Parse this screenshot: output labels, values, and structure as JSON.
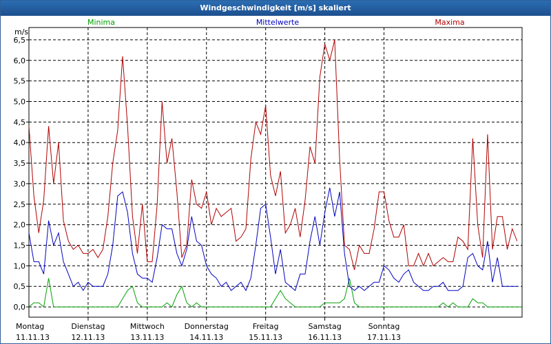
{
  "window": {
    "title": "Windgeschwindigkeit [m/s] skaliert"
  },
  "chart_data": {
    "type": "line",
    "title": "Windgeschwindigkeit [m/s] skaliert",
    "ylabel": "m/s",
    "ylim": [
      -0.25,
      6.8
    ],
    "yticks": [
      "0,0",
      "0,5",
      "1,0",
      "1,5",
      "2,0",
      "2,5",
      "3,0",
      "3,5",
      "4,0",
      "4,5",
      "5,0",
      "5,5",
      "6,0",
      "6,5"
    ],
    "grid": true,
    "x_start": "11.11.13 00:00",
    "x_step_hours": 2,
    "xtick_labels": [
      {
        "day": "Montag",
        "date": "11.11.13"
      },
      {
        "day": "Dienstag",
        "date": "12.11.13"
      },
      {
        "day": "Mittwoch",
        "date": "13.11.13"
      },
      {
        "day": "Donnerstag",
        "date": "14.11.13"
      },
      {
        "day": "Freitag",
        "date": "15.11.13"
      },
      {
        "day": "Samstag",
        "date": "16.11.13"
      },
      {
        "day": "Sonntag",
        "date": "17.11.13"
      }
    ],
    "colors": {
      "min": "#00a000",
      "mean": "#0000c0",
      "max": "#b00000",
      "grid": "#000000"
    },
    "series": [
      {
        "name": "Minima",
        "color": "#00a000",
        "values": [
          0,
          0.1,
          0.1,
          0,
          0.7,
          0,
          0,
          0,
          0,
          0,
          0,
          0,
          0,
          0,
          0,
          0,
          0,
          0,
          0,
          0.2,
          0.4,
          0.5,
          0.1,
          0,
          0,
          0,
          0,
          0,
          0.1,
          0,
          0.3,
          0.5,
          0.1,
          0,
          0.1,
          0,
          0,
          0,
          0,
          0,
          0,
          0,
          0,
          0,
          0,
          0,
          0,
          0,
          0,
          0,
          0.2,
          0.4,
          0.2,
          0.1,
          0,
          0,
          0,
          0,
          0,
          0,
          0.1,
          0.1,
          0.1,
          0.1,
          0.2,
          0.7,
          0.1,
          0,
          0,
          0,
          0,
          0,
          0,
          0,
          0,
          0,
          0,
          0,
          0,
          0,
          0,
          0,
          0,
          0,
          0.1,
          0,
          0.1,
          0,
          0,
          0,
          0.2,
          0.1,
          0.1,
          0,
          0,
          0,
          0,
          0,
          0,
          0,
          0
        ]
      },
      {
        "name": "Mittelwerte",
        "color": "#0000c0",
        "values": [
          1.8,
          1.1,
          1.1,
          0.8,
          2.1,
          1.5,
          1.8,
          1.1,
          0.8,
          0.5,
          0.6,
          0.4,
          0.6,
          0.5,
          0.5,
          0.5,
          0.8,
          1.5,
          2.7,
          2.8,
          2.3,
          1.3,
          0.8,
          0.7,
          0.7,
          0.6,
          1.2,
          2.0,
          1.9,
          1.9,
          1.3,
          1.0,
          1.4,
          2.2,
          1.6,
          1.5,
          1.0,
          0.8,
          0.7,
          0.5,
          0.6,
          0.4,
          0.5,
          0.6,
          0.4,
          0.7,
          1.5,
          2.4,
          2.5,
          1.7,
          0.8,
          1.4,
          0.6,
          0.5,
          0.4,
          0.8,
          0.8,
          1.6,
          2.2,
          1.5,
          2.3,
          2.9,
          2.2,
          2.8,
          1.3,
          0.5,
          0.4,
          0.5,
          0.4,
          0.5,
          0.6,
          0.6,
          1.0,
          0.9,
          0.7,
          0.6,
          0.8,
          0.9,
          0.6,
          0.5,
          0.4,
          0.4,
          0.5,
          0.5,
          0.6,
          0.4,
          0.4,
          0.4,
          0.5,
          1.2,
          1.3,
          1.0,
          0.9,
          1.6,
          0.6,
          1.2,
          0.5,
          0.5,
          0.5,
          0.5
        ]
      },
      {
        "name": "Maxima",
        "color": "#b00000",
        "values": [
          4.4,
          2.7,
          1.8,
          2.6,
          4.4,
          3.0,
          4.0,
          2.1,
          1.6,
          1.4,
          1.5,
          1.3,
          1.3,
          1.4,
          1.2,
          1.4,
          2.2,
          3.5,
          4.3,
          6.1,
          4.4,
          2.2,
          1.3,
          2.5,
          1.1,
          1.1,
          2.5,
          5.0,
          3.5,
          4.1,
          2.8,
          1.2,
          1.5,
          3.1,
          2.5,
          2.4,
          2.8,
          2.0,
          2.4,
          2.2,
          2.3,
          2.4,
          1.6,
          1.7,
          1.9,
          3.6,
          4.5,
          4.2,
          4.9,
          3.2,
          2.7,
          3.3,
          1.8,
          2.0,
          2.4,
          1.7,
          2.6,
          3.9,
          3.5,
          5.6,
          6.4,
          6.0,
          6.5,
          3.6,
          1.5,
          1.4,
          0.9,
          1.5,
          1.3,
          1.3,
          1.9,
          2.8,
          2.8,
          2.1,
          1.7,
          1.7,
          2.0,
          1.0,
          1.0,
          1.3,
          1.0,
          1.3,
          1.0,
          1.1,
          1.2,
          1.1,
          1.1,
          1.7,
          1.6,
          1.4,
          4.1,
          2.0,
          1.2,
          4.2,
          1.4,
          2.2,
          2.2,
          1.4,
          1.9,
          1.6
        ]
      }
    ]
  }
}
